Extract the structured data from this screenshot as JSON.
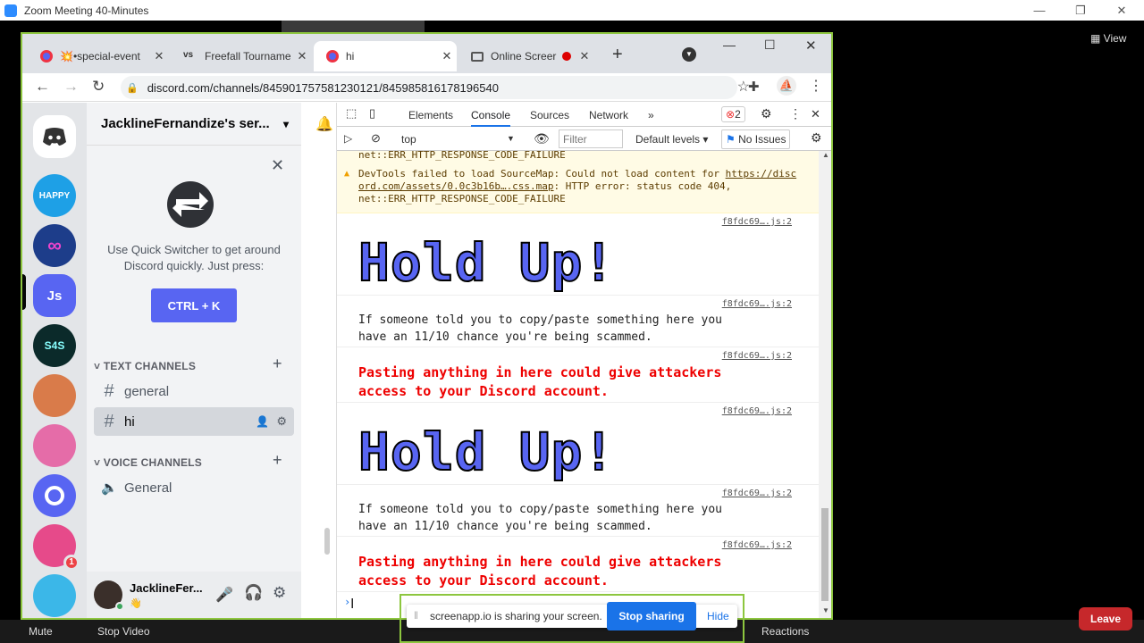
{
  "zoom": {
    "title": "Zoom Meeting 40-Minutes",
    "view_label": "View",
    "mute_label": "Mute",
    "stop_video_label": "Stop Video",
    "reactions_label": "Reactions",
    "leave_label": "Leave"
  },
  "browser": {
    "tabs": [
      {
        "title": "💥•special-event",
        "icon": "discord-icon"
      },
      {
        "title": "Freefall Tourname",
        "icon": "vs-icon"
      },
      {
        "title": "hi",
        "icon": "discord-icon",
        "active": true
      },
      {
        "title": "Online Screer",
        "icon": "monitor-icon"
      }
    ],
    "url": "discord.com/channels/845901757581230121/845985816178196540"
  },
  "discord": {
    "server_name": "JacklineFernandize's ser...",
    "quick_switcher": {
      "text": "Use Quick Switcher to get around Discord quickly. Just press:",
      "button": "CTRL + K"
    },
    "text_channels_label": "TEXT CHANNELS",
    "voice_channels_label": "VOICE CHANNELS",
    "channels": {
      "general": "general",
      "hi": "hi",
      "voice": "General"
    },
    "guilds": [
      {
        "label": "HAPPY",
        "color": "#1ea0e6"
      },
      {
        "label": "∞",
        "color": "#1d3d8a"
      },
      {
        "label": "Js",
        "color": "#5865f2"
      },
      {
        "label": "S4S",
        "color": "#0b2a2a"
      },
      {
        "label": "",
        "color": "#d97b4a"
      },
      {
        "label": "",
        "color": "#e56ca8"
      },
      {
        "label": "",
        "color": "#5865f2"
      },
      {
        "label": "",
        "color": "#e64a8a",
        "badge": "1"
      },
      {
        "label": "",
        "color": "#3bb7e8"
      }
    ],
    "user": {
      "name": "JacklineFer...",
      "status": "👋"
    }
  },
  "devtools": {
    "tabs": [
      "Elements",
      "Console",
      "Sources",
      "Network"
    ],
    "error_count": "2",
    "context": "top",
    "filter_placeholder": "Filter",
    "levels": "Default levels",
    "issues": "No Issues",
    "warning_prev": "net::ERR_HTTP_RESPONSE_CODE_FAILURE",
    "warning_line1": "DevTools failed to load SourceMap: Could not load content for ",
    "warning_link1": "https://disc",
    "warning_link2": "ord.com/assets/0.0c3b16b….css.map",
    "warning_line2": ": HTTP error: status code 404,",
    "warning_line3": "net::ERR_HTTP_RESPONSE_CODE_FAILURE",
    "source": "f8fdc69….js:2",
    "hold_up": "Hold Up!",
    "scam_text": "If someone told you to copy/paste something here you\nhave an 11/10 chance you're being scammed.",
    "danger_text": "Pasting anything in here could give attackers\naccess to your Discord account."
  },
  "share_bar": {
    "text": "screenapp.io is sharing your screen.",
    "stop_label": "Stop sharing",
    "hide_label": "Hide"
  }
}
